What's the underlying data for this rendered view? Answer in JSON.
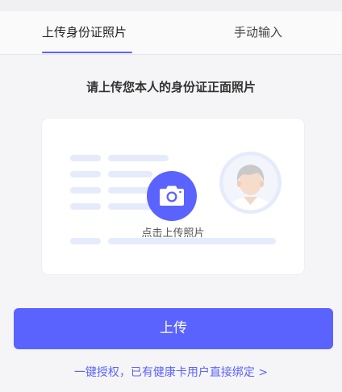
{
  "tabs": [
    {
      "label": "上传身份证照片",
      "active": true
    },
    {
      "label": "手动输入",
      "active": false
    }
  ],
  "instruction": "请上传您本人的身份证正面照片",
  "upload_card": {
    "hint": "点击上传照片",
    "camera_icon": "camera-icon",
    "avatar_icon": "person-avatar-icon"
  },
  "upload_button": {
    "label": "上传"
  },
  "bind_link": {
    "label": "一键授权，已有健康卡用户直接绑定 >"
  },
  "colors": {
    "accent": "#5b63ff",
    "placeholder": "#e6ebfb",
    "background": "#f5f5f7"
  }
}
